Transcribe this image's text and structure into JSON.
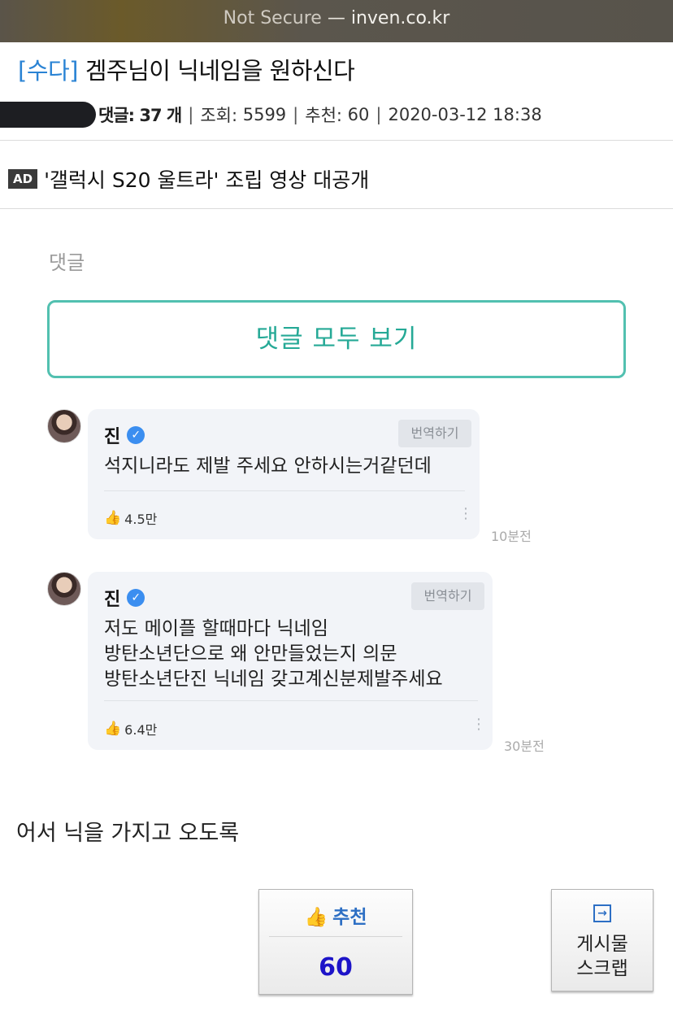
{
  "browser": {
    "security": "Not Secure",
    "dash": "—",
    "host": "inven.co.kr"
  },
  "post": {
    "category": "[수다]",
    "title": "겜주님이 닉네임을 원하신다",
    "comments_label": "댓글:",
    "comments_count": "37",
    "comments_unit": "개",
    "views_label": "조회:",
    "views": "5599",
    "recommend_label": "추천:",
    "recommend": "60",
    "date": "2020-03-12 18:38"
  },
  "ad": {
    "badge": "AD",
    "text": "'갤럭시 S20 울트라' 조립 영상 대공개"
  },
  "comments_section": {
    "label": "댓글",
    "view_all": "댓글 모두 보기",
    "items": [
      {
        "name": "진",
        "translate": "번역하기",
        "text": "석지니라도 제발 주세요 안하시는거같던데",
        "likes": "4.5만",
        "time": "10분전"
      },
      {
        "name": "진",
        "translate": "번역하기",
        "text": "저도 메이플 할때마다 닉네임\n방탄소년단으로 왜 안만들었는지 의문\n방탄소년단진 닉네임 갖고계신분제발주세요",
        "likes": "6.4만",
        "time": "30분전"
      }
    ]
  },
  "body_text": "어서 닉을 가지고 오도록",
  "actions": {
    "recommend_label": "추천",
    "recommend_count": "60",
    "scrap_label": "게시물\n스크랩"
  },
  "colors": {
    "accent_teal": "#25a996",
    "category_blue": "#2a83d4",
    "recommend_count": "#1d14c8"
  }
}
